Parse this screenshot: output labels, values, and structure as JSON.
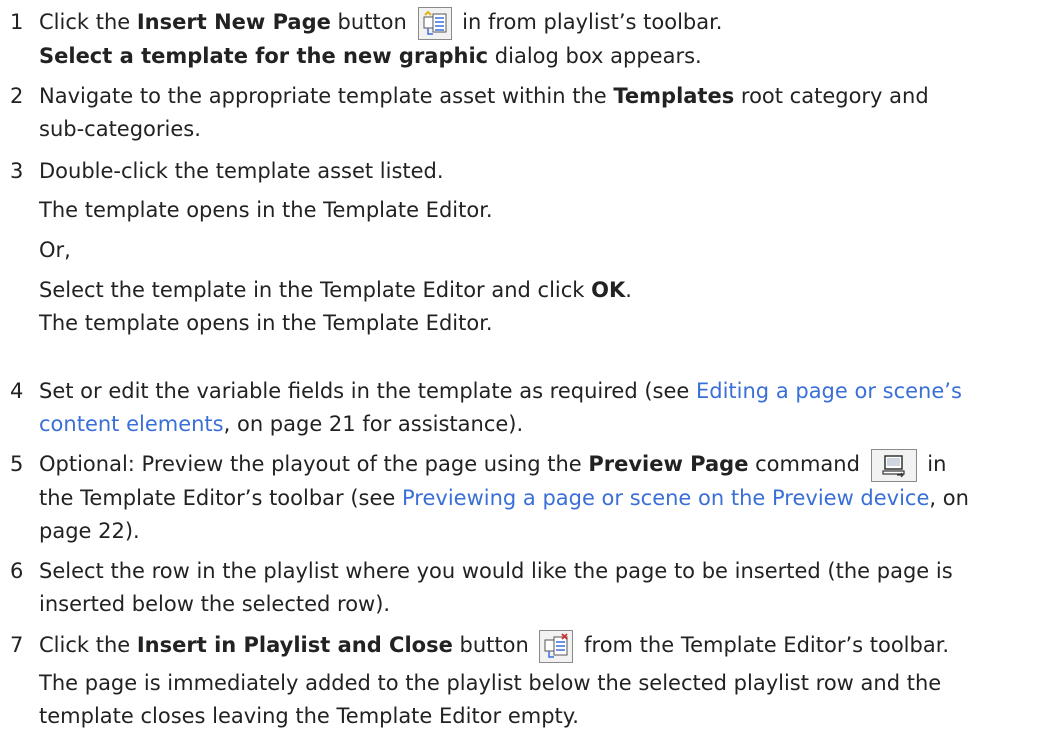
{
  "steps": [
    {
      "num": "1",
      "a1": "Click the ",
      "b1": "Insert New Page",
      "a2": " button ",
      "a3": " in from playlist’s toolbar.",
      "l2_bold": "Select a template for the new graphic",
      "l2_rest": " dialog box appears."
    },
    {
      "num": "2",
      "a1": "Navigate to the appropriate template asset within the ",
      "b1": "Templates",
      "a2": " root category and",
      "l2": "sub-categories."
    },
    {
      "num": "3",
      "l1": "Double-click the template asset listed.",
      "l2": "The template opens in the Template Editor.",
      "l3": "Or,",
      "l4a": "Select the template in the Template Editor and click ",
      "l4b": "OK",
      "l4c": ".",
      "l5": "The template opens in the Template Editor."
    },
    {
      "num": "4",
      "a1": "Set or edit the variable fields in the template as required (see ",
      "link1": "Editing a page or scene’s",
      "link2": "content elements",
      "a2": ", on page 21 for assistance)."
    },
    {
      "num": "5",
      "a1": "Optional: Preview the playout of the page using the ",
      "b1": "Preview Page",
      "a2": " command ",
      "a3": " in",
      "l2a": "the Template Editor’s toolbar (see ",
      "link": "Previewing a page or scene on the Preview device",
      "l2b": ", on",
      "l3": "page 22)."
    },
    {
      "num": "6",
      "l1": "Select the row in the playlist where you would like the page to be inserted (the page is",
      "l2": "inserted below the selected row)."
    },
    {
      "num": "7",
      "a1": "Click the ",
      "b1": "Insert in Playlist and Close",
      "a2": " button ",
      "a3": " from the Template Editor’s toolbar.",
      "l2": "The page is immediately added to the playlist below the selected playlist row and the",
      "l3": "template closes leaving the Template Editor empty."
    }
  ],
  "colors": {
    "link": "#3a6fd8",
    "text": "#222222"
  },
  "icons": {
    "insert_new_page": "insert-new-page-icon",
    "preview_page": "preview-page-icon",
    "insert_and_close": "insert-in-playlist-and-close-icon"
  }
}
